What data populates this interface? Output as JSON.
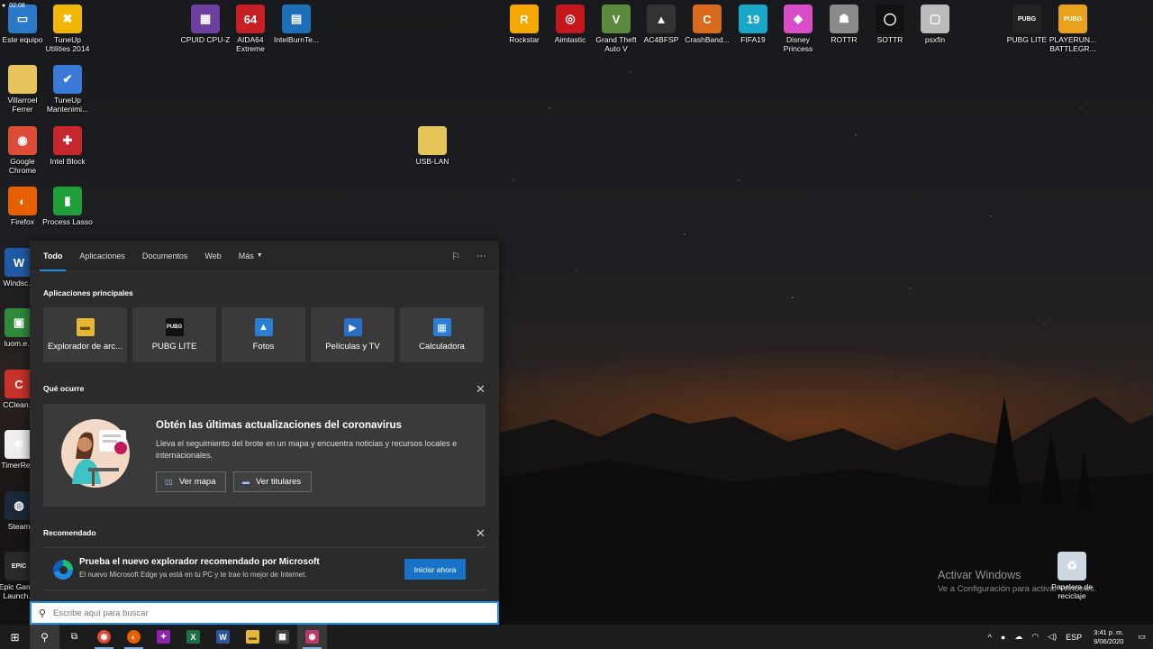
{
  "desktop_icons": [
    {
      "label": "Este equipo",
      "icon": "computer-icon",
      "color": "#2b79c8",
      "glyph": "▭"
    },
    {
      "label": "TuneUp\nUtilities 2014",
      "icon": "tuneup-icon",
      "color": "#f2b705",
      "glyph": "✖"
    },
    {
      "label": "Villarroel\nFerrer",
      "icon": "folder-icon",
      "color": "#e6c45a",
      "glyph": ""
    },
    {
      "label": "TuneUp\nMantenimi...",
      "icon": "tuneup-maintenance-icon",
      "color": "#3b79d6",
      "glyph": "✔"
    },
    {
      "label": "Google\nChrome",
      "icon": "chrome-icon",
      "color": "#dd4b39",
      "glyph": "◉"
    },
    {
      "label": "Intel Block",
      "icon": "intel-block-icon",
      "color": "#c6262e",
      "glyph": "✚"
    },
    {
      "label": "Firefox",
      "icon": "firefox-icon",
      "color": "#e66000",
      "glyph": "◐"
    },
    {
      "label": "Process Lasso",
      "icon": "process-lasso-icon",
      "color": "#1f9e3a",
      "glyph": "▮"
    },
    {
      "label": "CPUID CPU-Z",
      "icon": "cpuz-icon",
      "color": "#6c3fa0",
      "glyph": "▦"
    },
    {
      "label": "AIDA64\nExtreme",
      "icon": "aida64-icon",
      "color": "#c61f26",
      "glyph": "64"
    },
    {
      "label": "IntelBurnTe...",
      "icon": "intelburntest-icon",
      "color": "#1d6fb8",
      "glyph": "▤"
    },
    {
      "label": "USB-LAN",
      "icon": "usb-lan-folder-icon",
      "color": "#e6c45a",
      "glyph": ""
    },
    {
      "label": "Rockstar",
      "icon": "rockstar-icon",
      "color": "#f5a800",
      "glyph": "R"
    },
    {
      "label": "Aimtastic",
      "icon": "aimtastic-icon",
      "color": "#c4161c",
      "glyph": "◎"
    },
    {
      "label": "Grand Theft\nAuto V",
      "icon": "gta-icon",
      "color": "#5b8a3c",
      "glyph": "V"
    },
    {
      "label": "AC4BFSP",
      "icon": "assassins-creed-icon",
      "color": "#333333",
      "glyph": "▲"
    },
    {
      "label": "CrashBand...",
      "icon": "crash-bandicoot-icon",
      "color": "#d96b1f",
      "glyph": "C"
    },
    {
      "label": "FIFA19",
      "icon": "fifa19-icon",
      "color": "#18a7c9",
      "glyph": "19"
    },
    {
      "label": "Disney\nPrincess",
      "icon": "disney-princess-icon",
      "color": "#d84ec6",
      "glyph": "◆"
    },
    {
      "label": "ROTTR",
      "icon": "rottr-icon",
      "color": "#8a8a8a",
      "glyph": "☗"
    },
    {
      "label": "SOTTR",
      "icon": "sottr-icon",
      "color": "#111111",
      "glyph": "◯"
    },
    {
      "label": "psxfin",
      "icon": "psxfin-icon",
      "color": "#bbbbbb",
      "glyph": "▢"
    },
    {
      "label": "PUBG LITE",
      "icon": "pubg-lite-icon",
      "color": "#222222",
      "glyph": "PUBG"
    },
    {
      "label": "PLAYERUN...\nBATTLEGR...",
      "icon": "pubg-icon",
      "color": "#e8a21b",
      "glyph": "PUBG"
    },
    {
      "label": "Windsc...",
      "icon": "windscribe-icon",
      "color": "#1f5aa6",
      "glyph": "W"
    },
    {
      "label": "luom.e...",
      "icon": "luom-icon",
      "color": "#2e8b3c",
      "glyph": "▣"
    },
    {
      "label": "CClean...",
      "icon": "ccleaner-icon",
      "color": "#c8312a",
      "glyph": "C"
    },
    {
      "label": "TimerRe...",
      "icon": "timer-icon",
      "color": "#eeeeee",
      "glyph": "✱"
    },
    {
      "label": "Steam",
      "icon": "steam-icon",
      "color": "#1b2838",
      "glyph": "◍"
    },
    {
      "label": "Epic Gam...\nLaunch...",
      "icon": "epic-games-icon",
      "color": "#2a2a2a",
      "glyph": "EPIC"
    },
    {
      "label": "Papelera de\nreciclaje",
      "icon": "recycle-bin-icon",
      "color": "#cfd8e0",
      "glyph": "♻"
    }
  ],
  "search_panel": {
    "tabs": [
      {
        "label": "Todo",
        "active": true
      },
      {
        "label": "Aplicaciones",
        "active": false
      },
      {
        "label": "Documentos",
        "active": false
      },
      {
        "label": "Web",
        "active": false
      },
      {
        "label": "Más",
        "active": false
      }
    ],
    "apps_title": "Aplicaciones principales",
    "apps": [
      {
        "label": "Explorador de arc...",
        "icon": "file-explorer-icon",
        "color": "#e6b735",
        "glyph": "▬"
      },
      {
        "label": "PUBG LITE",
        "icon": "pubg-lite-icon",
        "color": "#111111",
        "glyph": "PUBG"
      },
      {
        "label": "Fotos",
        "icon": "photos-icon",
        "color": "#2a7ed3",
        "glyph": "▲"
      },
      {
        "label": "Películas y TV",
        "icon": "movies-tv-icon",
        "color": "#2a6fc7",
        "glyph": "▶"
      },
      {
        "label": "Calculadora",
        "icon": "calculator-icon",
        "color": "#2a7ed3",
        "glyph": "▦"
      }
    ],
    "news_title": "Qué ocurre",
    "news": {
      "heading": "Obtén las últimas actualizaciones del coronavirus",
      "body": "Lleva el seguimiento del brote en un mapa y encuentra noticias y recursos locales e internacionales.",
      "btn_map": "Ver mapa",
      "btn_headlines": "Ver titulares"
    },
    "rec_title": "Recomendado",
    "rec": {
      "heading": "Prueba el nuevo explorador recomendado por Microsoft",
      "sub": "El nuevo Microsoft Edge ya está en tu PC y te trae lo mejor de Internet.",
      "cta": "Iniciar ahora"
    },
    "search_placeholder": "Escribe aquí para buscar"
  },
  "watermark": {
    "line1": "Activar Windows",
    "line2": "Ve a Configuración para activar Windows."
  },
  "tray": {
    "language": "ESP",
    "time": "3:41 p. m.",
    "date": "9/06/2020",
    "chevron": "^"
  },
  "overlay_time": "02:08",
  "colors": {
    "accent": "#1f8fe6",
    "panel_bg": "#2b2b2b",
    "tile_bg": "#3a3a3a",
    "cta_bg": "#1673c7"
  }
}
